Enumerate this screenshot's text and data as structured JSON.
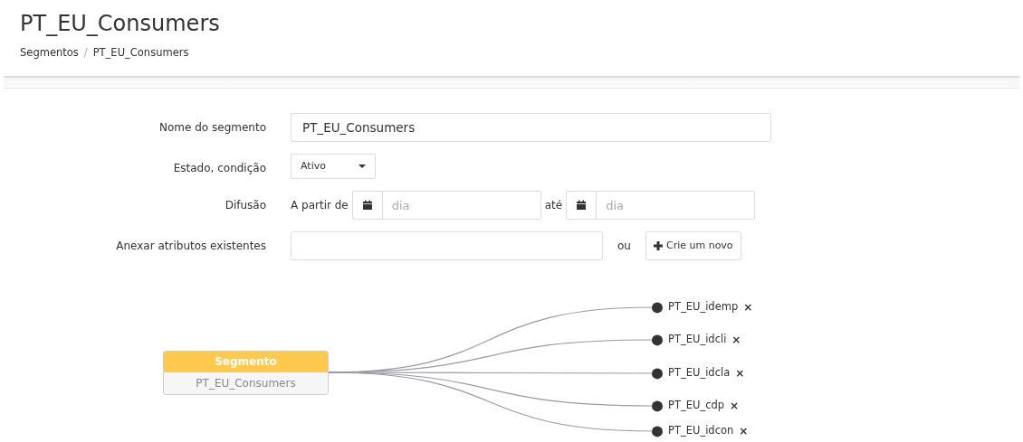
{
  "page_title": "PT_EU_Consumers",
  "breadcrumb": {
    "items": [
      "Segmentos",
      "PT_EU_Consumers"
    ],
    "separator": "/"
  },
  "form": {
    "name": {
      "label": "Nome do segmento",
      "value": "PT_EU_Consumers"
    },
    "status": {
      "label": "Estado, condição",
      "value": "Ativo"
    },
    "diffusion": {
      "label": "Difusão",
      "from_label": "A partir de",
      "from_placeholder": "dia",
      "to_label": "até",
      "to_placeholder": "dia"
    },
    "attributes": {
      "label": "Anexar atributos existentes",
      "or_label": "ou",
      "create_button": "Crie um novo"
    }
  },
  "diagram": {
    "root": {
      "header": "Segmento",
      "name": "PT_EU_Consumers"
    },
    "attributes": [
      {
        "label": "PT_EU_idemp",
        "remove": "×"
      },
      {
        "label": "PT_EU_idcli",
        "remove": "×"
      },
      {
        "label": "PT_EU_idcla",
        "remove": "×"
      },
      {
        "label": "PT_EU_cdp",
        "remove": "×"
      },
      {
        "label": "PT_EU_idcon",
        "remove": "×"
      }
    ]
  }
}
